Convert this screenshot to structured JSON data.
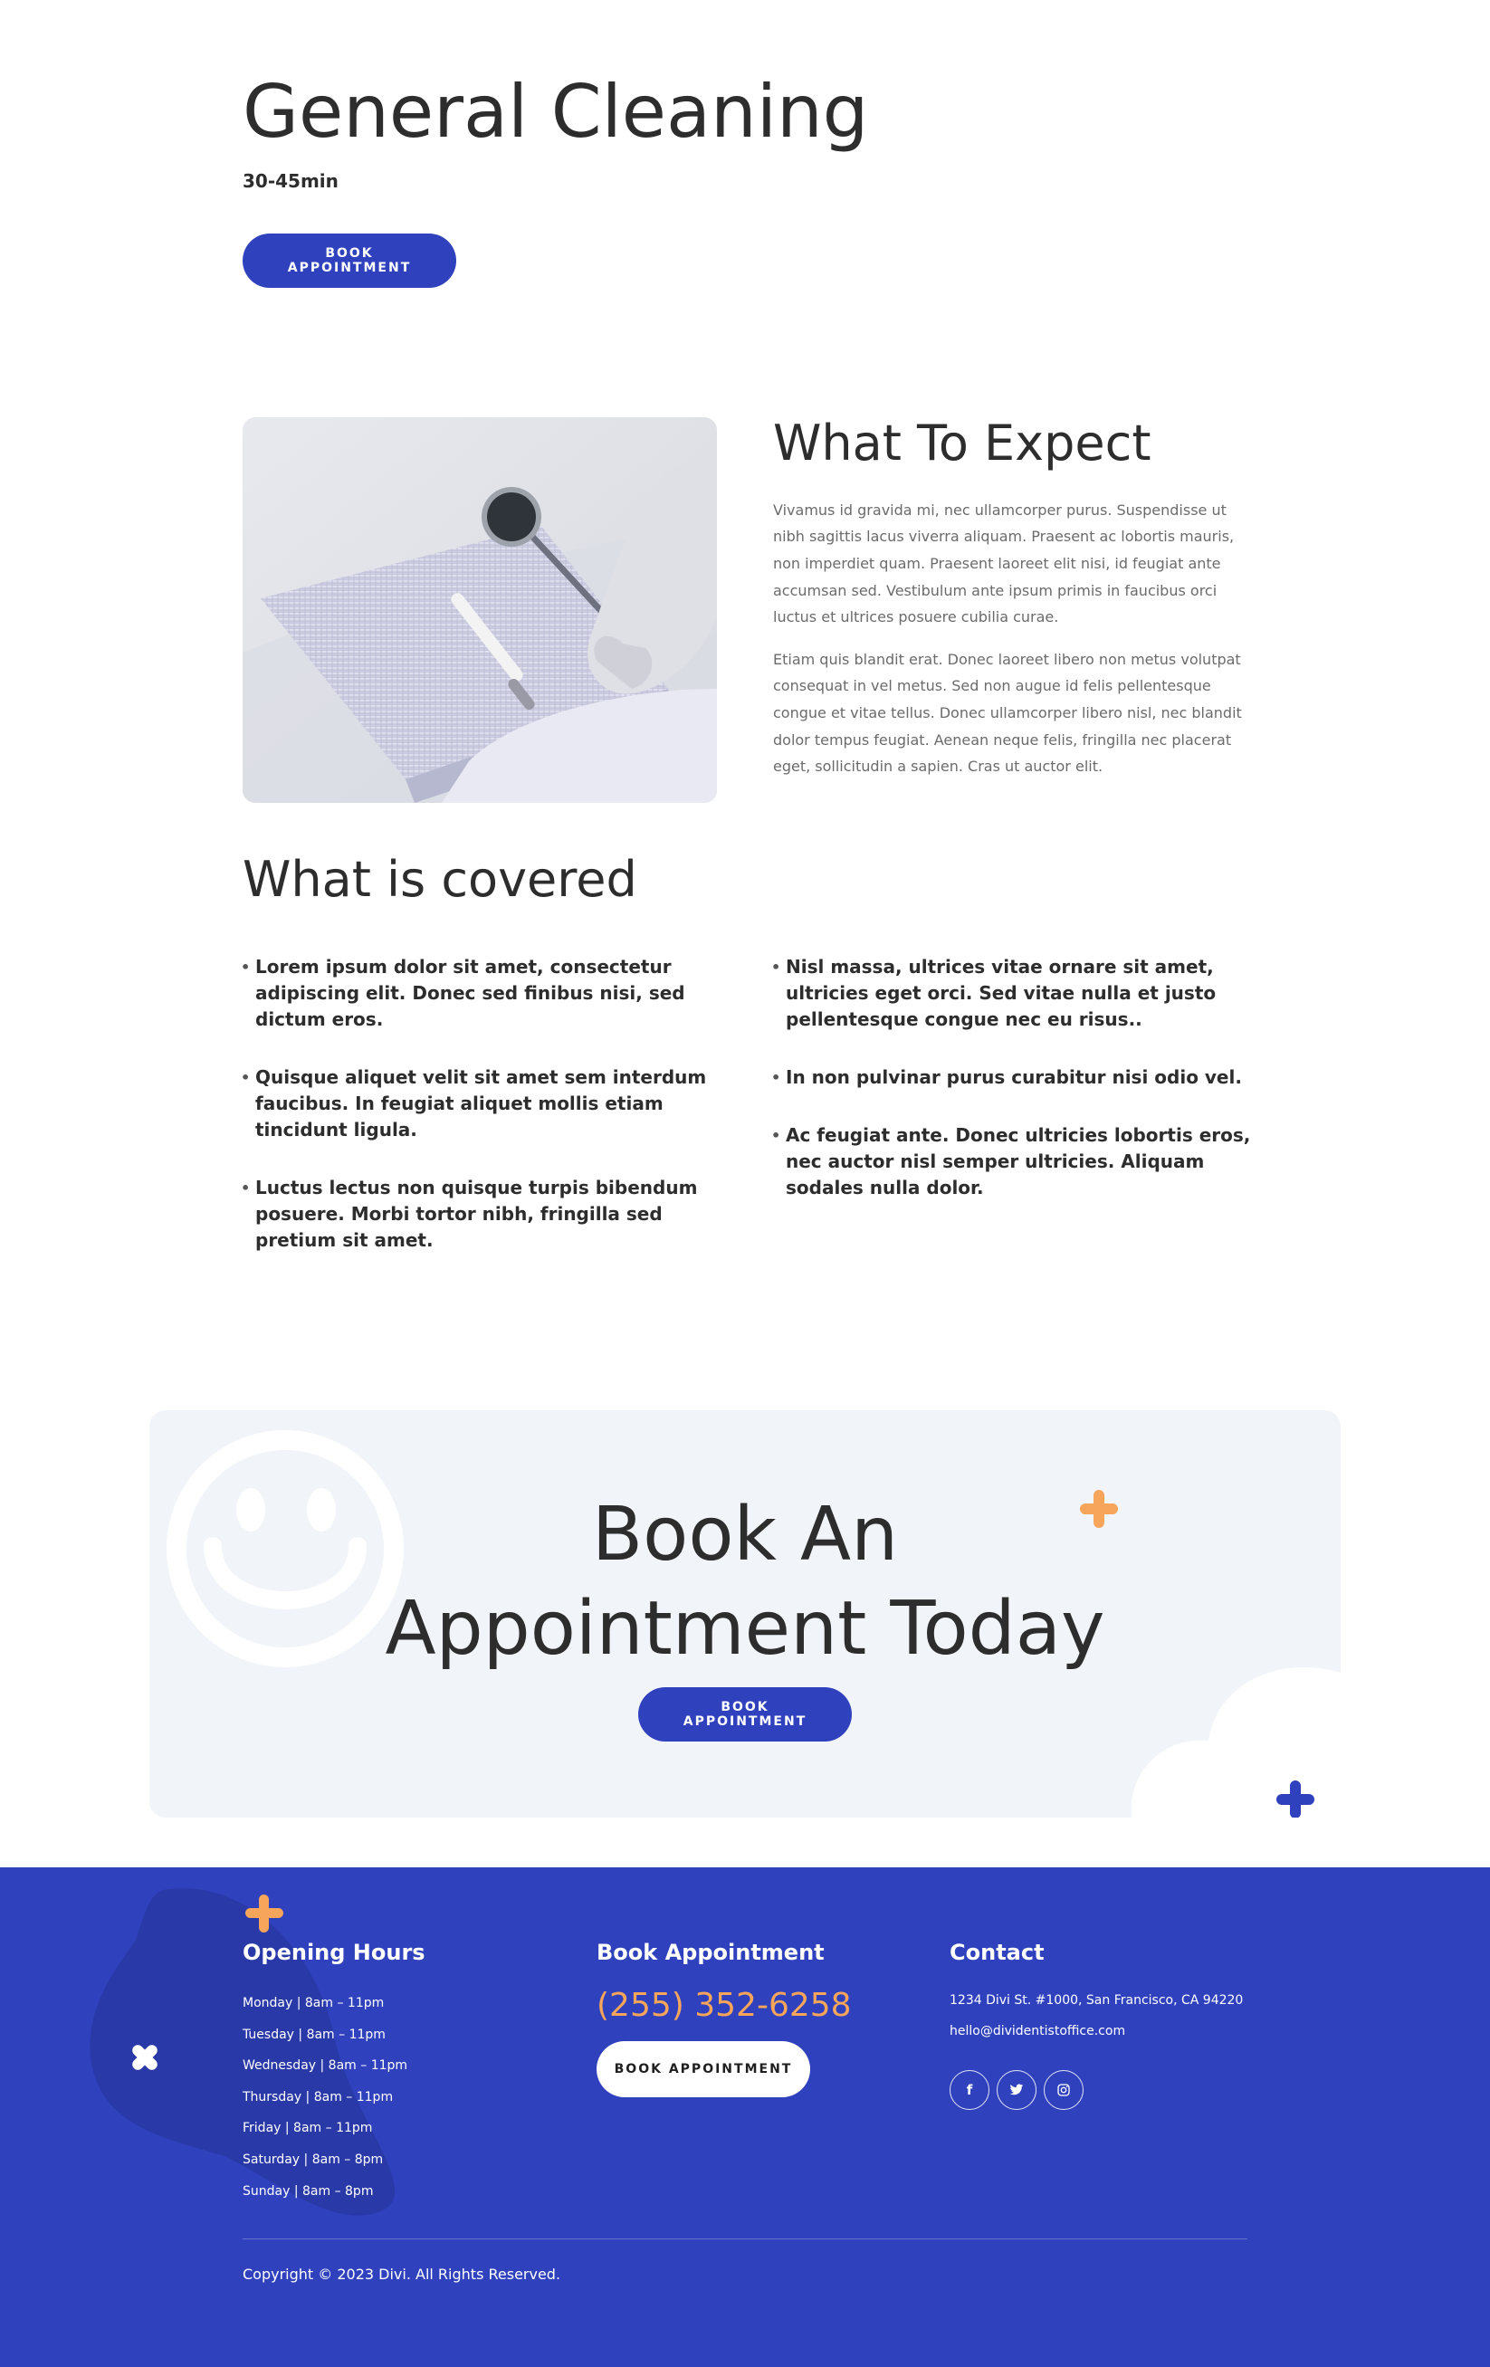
{
  "hero": {
    "title": "General Cleaning",
    "duration": "30-45min",
    "button_label": "BOOK APPOINTMENT"
  },
  "expect": {
    "image_icon": "dental-mirror-image",
    "title": "What To Expect",
    "paragraphs": [
      "Vivamus id gravida mi, nec ullamcorper purus. Suspendisse ut nibh sagittis lacus viverra aliquam. Praesent ac lobortis mauris, non imperdiet quam. Praesent laoreet elit nisi, id feugiat ante accumsan sed. Vestibulum ante ipsum primis in faucibus orci luctus et ultrices posuere cubilia curae.",
      "Etiam quis blandit erat. Donec laoreet libero non metus volutpat consequat in vel metus. Sed non augue id felis pellentesque congue et vitae tellus. Donec ullamcorper libero nisl, nec blandit dolor tempus feugiat. Aenean neque felis, fringilla nec placerat eget, sollicitudin a sapien. Cras ut auctor elit."
    ]
  },
  "covered": {
    "title": "What is covered",
    "left": [
      "Lorem ipsum dolor sit amet, consectetur adipiscing elit. Donec sed finibus nisi, sed dictum eros.",
      "Quisque aliquet velit sit amet sem interdum faucibus. In feugiat aliquet mollis etiam tincidunt ligula.",
      "Luctus lectus non quisque turpis bibendum posuere. Morbi tortor nibh, fringilla sed pretium sit amet."
    ],
    "right": [
      "Nisl massa, ultrices vitae ornare sit amet, ultricies eget orci. Sed vitae nulla et justo pellentesque congue nec eu risus..",
      "In non pulvinar purus curabitur nisi odio vel.",
      "Ac feugiat ante. Donec ultricies lobortis eros, nec auctor nisl semper ultricies. Aliquam sodales nulla dolor."
    ]
  },
  "cta": {
    "title_line1": "Book An",
    "title_line2": "Appointment Today",
    "button_label": "BOOK APPOINTMENT"
  },
  "footer": {
    "hours_title": "Opening Hours",
    "hours": [
      "Monday | 8am – 11pm",
      "Tuesday | 8am – 11pm",
      "Wednesday | 8am – 11pm",
      "Thursday | 8am – 11pm",
      "Friday | 8am – 11pm",
      "Saturday | 8am – 8pm",
      "Sunday | 8am – 8pm"
    ],
    "book_title": "Book Appointment",
    "phone": "(255) 352-6258",
    "book_button": "BOOK APPOINTMENT",
    "contact_title": "Contact",
    "address": "1234 Divi St. #1000, San Francisco, CA 94220",
    "email": "hello@dividentistoffice.com",
    "social": [
      "facebook-icon",
      "twitter-icon",
      "instagram-icon"
    ],
    "copyright": "Copyright © 2023 Divi. All Rights Reserved."
  },
  "colors": {
    "primary": "#2f41bd",
    "accent": "#f6a55b",
    "text_dark": "#2d2d2d",
    "cta_bg": "#f1f4f8"
  }
}
